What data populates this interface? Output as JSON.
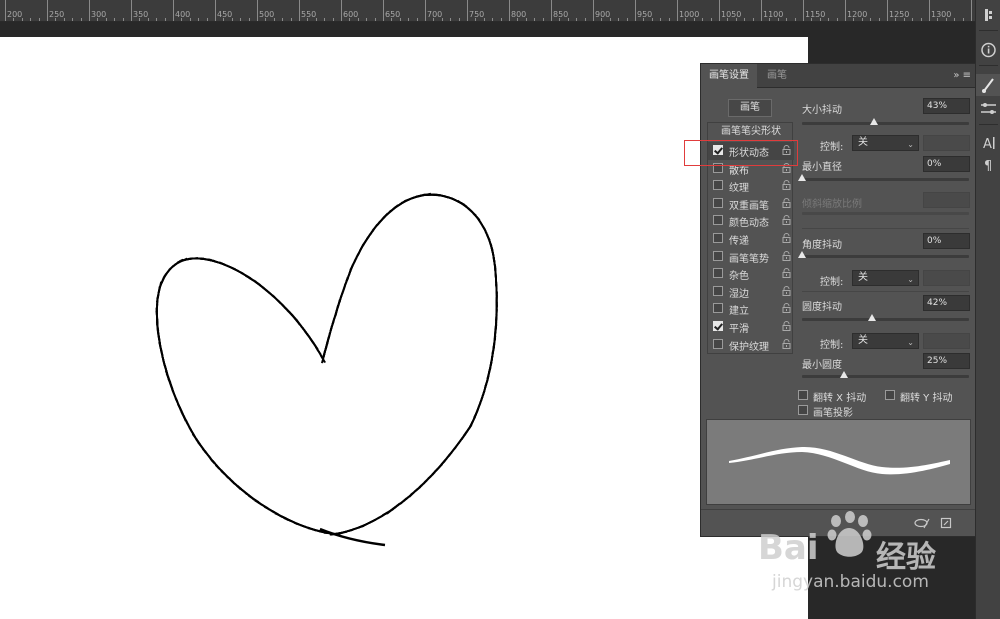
{
  "ruler": {
    "labels": [
      "200",
      "250",
      "300",
      "350",
      "400",
      "450",
      "500",
      "550",
      "600",
      "650",
      "700",
      "750",
      "800",
      "850",
      "900",
      "950",
      "1000",
      "1050",
      "1100",
      "1150",
      "1200",
      "1250",
      "1300"
    ]
  },
  "panel": {
    "tabs": [
      {
        "label": "画笔设置",
        "active": true
      },
      {
        "label": "画笔",
        "active": false
      }
    ],
    "menu_glyph": "»  ≡",
    "brush_button": "画笔",
    "tip_shape": "画笔笔尖形状",
    "options": [
      {
        "label": "形状动态",
        "checked": true,
        "lock": true
      },
      {
        "label": "散布",
        "checked": false,
        "lock": true
      },
      {
        "label": "纹理",
        "checked": false,
        "lock": true
      },
      {
        "label": "双重画笔",
        "checked": false,
        "lock": true
      },
      {
        "label": "颜色动态",
        "checked": false,
        "lock": true
      },
      {
        "label": "传递",
        "checked": false,
        "lock": true
      },
      {
        "label": "画笔笔势",
        "checked": false,
        "lock": true
      },
      {
        "label": "杂色",
        "checked": false,
        "lock": true
      },
      {
        "label": "湿边",
        "checked": false,
        "lock": true
      },
      {
        "label": "建立",
        "checked": false,
        "lock": true
      },
      {
        "label": "平滑",
        "checked": true,
        "lock": true
      },
      {
        "label": "保护纹理",
        "checked": false,
        "lock": true
      }
    ],
    "size_jitter": {
      "label": "大小抖动",
      "value": "43%",
      "level": 0.43
    },
    "size_control": {
      "label": "控制:",
      "value": "关"
    },
    "min_diameter": {
      "label": "最小直径",
      "value": "0%",
      "level": 0.0
    },
    "tilt_scale": {
      "label": "倾斜缩放比例"
    },
    "angle_jitter": {
      "label": "角度抖动",
      "value": "0%",
      "level": 0.0
    },
    "angle_control": {
      "label": "控制:",
      "value": "关"
    },
    "roundness_jitter": {
      "label": "圆度抖动",
      "value": "42%",
      "level": 0.42
    },
    "roundness_control": {
      "label": "控制:",
      "value": "关"
    },
    "min_roundness": {
      "label": "最小圆度",
      "value": "25%",
      "level": 0.25
    },
    "flip_x": {
      "label": "翻转 X 抖动",
      "checked": false
    },
    "flip_y": {
      "label": "翻转 Y 抖动",
      "checked": false
    },
    "brush_projection": {
      "label": "画笔投影",
      "checked": false
    }
  },
  "right_strip": {
    "icons": [
      "ruler-settings-icon",
      "info-icon",
      "brush-icon",
      "brush-settings-icon",
      "character-icon",
      "paragraph-icon"
    ]
  },
  "watermark": {
    "line1": "Bai",
    "line2": "经验",
    "url": "jingyan.baidu.com"
  }
}
